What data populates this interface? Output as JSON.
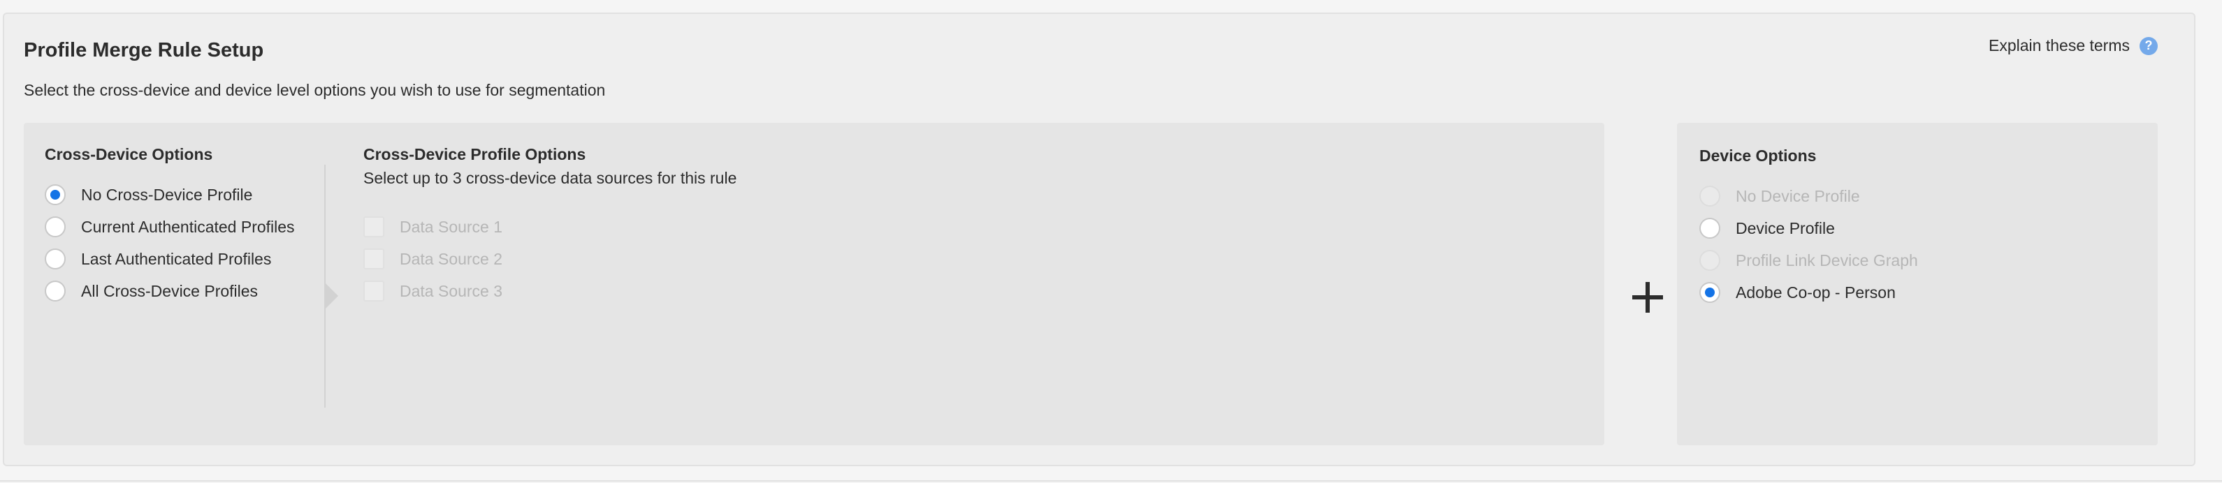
{
  "page": {
    "title": "Profile Merge Rule Setup",
    "subtitle": "Select the cross-device and device level options you wish to use for segmentation",
    "explain_link": "Explain these terms",
    "help_icon": "question-mark-icon"
  },
  "cross_device": {
    "heading": "Cross-Device Options",
    "options": [
      {
        "label": "No Cross-Device Profile",
        "checked": true
      },
      {
        "label": "Current Authenticated Profiles",
        "checked": false
      },
      {
        "label": "Last Authenticated Profiles",
        "checked": false
      },
      {
        "label": "All Cross-Device Profiles",
        "checked": false
      }
    ]
  },
  "cross_device_profile": {
    "heading": "Cross-Device Profile Options",
    "subheading": "Select up to 3 cross-device data sources for this rule",
    "sources": [
      {
        "label": "Data Source 1",
        "disabled": true
      },
      {
        "label": "Data Source 2",
        "disabled": true
      },
      {
        "label": "Data Source 3",
        "disabled": true
      }
    ]
  },
  "device": {
    "heading": "Device Options",
    "options": [
      {
        "label": "No Device Profile",
        "checked": false,
        "disabled": true
      },
      {
        "label": "Device Profile",
        "checked": false,
        "disabled": false
      },
      {
        "label": "Profile Link Device Graph",
        "checked": false,
        "disabled": true
      },
      {
        "label": "Adobe Co-op - Person",
        "checked": true,
        "disabled": false
      }
    ]
  },
  "colors": {
    "accent": "#1473e6",
    "help_icon": "#74a9ea",
    "panel_bg": "#e5e5e5",
    "card_bg": "#efefef",
    "disabled_text": "#b6b6b6"
  }
}
